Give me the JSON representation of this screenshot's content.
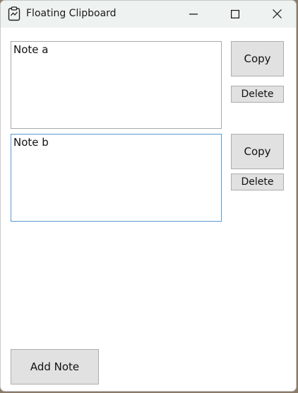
{
  "window": {
    "title": "Floating Clipboard",
    "icon": "clipboard-icon",
    "controls": [
      "minimize-icon",
      "maximize-icon",
      "close-icon"
    ]
  },
  "notes": [
    {
      "text": "Note a",
      "copy_label": "Copy",
      "delete_label": "Delete"
    },
    {
      "text": "Note b",
      "copy_label": "Copy",
      "delete_label": "Delete"
    }
  ],
  "footer": {
    "add_label": "Add Note"
  },
  "colors": {
    "titlebar": "#eef3f1",
    "button_face": "#e1e1e1",
    "focus_border": "#5a98d0"
  }
}
